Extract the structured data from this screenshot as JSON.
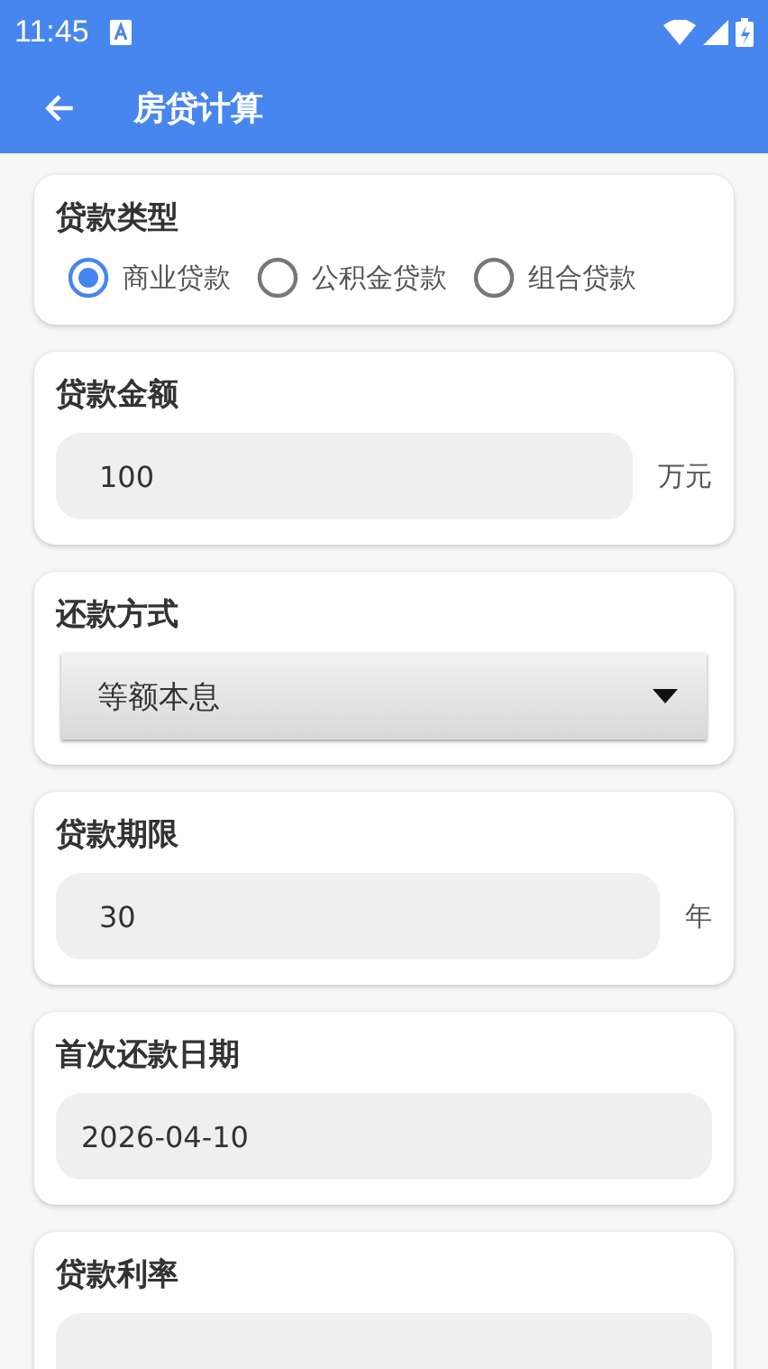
{
  "status_bar": {
    "time": "11:45"
  },
  "app_bar": {
    "title": "房贷计算"
  },
  "cards": [
    {
      "kind": "radio",
      "title": "贷款类型",
      "options": [
        {
          "label": "商业贷款",
          "selected": true
        },
        {
          "label": "公积金贷款",
          "selected": false
        },
        {
          "label": "组合贷款",
          "selected": false
        }
      ]
    },
    {
      "kind": "field",
      "title": "贷款金额",
      "value": "100",
      "unit": "万元"
    },
    {
      "kind": "dropdown",
      "title": "还款方式",
      "value": "等额本息"
    },
    {
      "kind": "field",
      "title": "贷款期限",
      "value": "30",
      "unit": "年"
    },
    {
      "kind": "date",
      "title": "首次还款日期",
      "value": "2026-04-10"
    },
    {
      "kind": "field",
      "title": "贷款利率"
    }
  ]
}
